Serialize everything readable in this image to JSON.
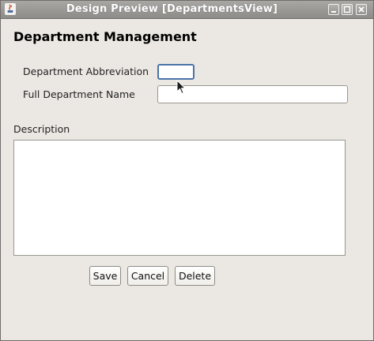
{
  "window": {
    "title": "Design Preview [DepartmentsView]",
    "icons": [
      "java-app-icon",
      "minimize-icon",
      "maximize-icon",
      "close-icon"
    ]
  },
  "form": {
    "heading": "Department Management",
    "abbreviation_label": "Department Abbreviation",
    "abbreviation_value": "",
    "full_name_label": "Full Department Name",
    "full_name_value": "",
    "description_label": "Description",
    "description_value": ""
  },
  "buttons": {
    "save": "Save",
    "cancel": "Cancel",
    "delete": "Delete"
  },
  "colors": {
    "window_bg": "#ebe8e3",
    "titlebar": "#9d9b98",
    "focus_border": "#4a73a8"
  }
}
